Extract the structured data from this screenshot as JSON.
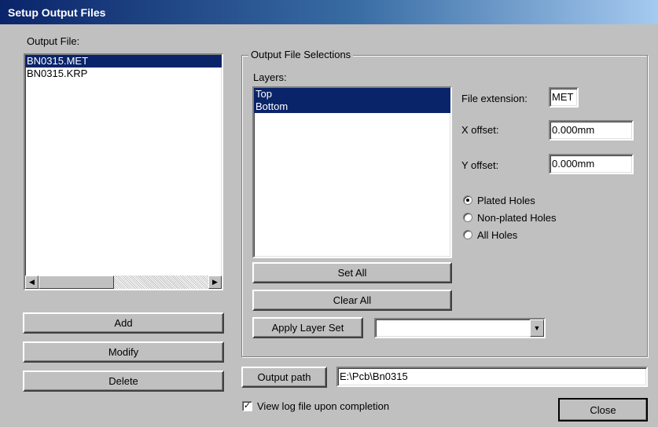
{
  "window": {
    "title": "Setup Output Files"
  },
  "output_file": {
    "label": "Output File:",
    "items": [
      "BN0315.MET",
      "BN0315.KRP"
    ],
    "selected_index": 0
  },
  "buttons": {
    "add": "Add",
    "modify": "Modify",
    "delete": "Delete"
  },
  "selections": {
    "group_title": "Output File Selections",
    "layers_label": "Layers:",
    "layers": [
      "Top",
      "Bottom"
    ],
    "set_all": "Set All",
    "clear_all": "Clear All",
    "apply_layer_set": "Apply Layer Set",
    "layer_set_value": "",
    "file_extension_label": "File extension:",
    "file_extension": "MET",
    "x_offset_label": "X offset:",
    "x_offset": "0.000mm",
    "y_offset_label": "Y offset:",
    "y_offset": "0.000mm",
    "holes": {
      "options": [
        "Plated Holes",
        "Non-plated Holes",
        "All Holes"
      ],
      "selected": "Plated Holes"
    }
  },
  "output_path": {
    "button": "Output path",
    "value": "E:\\Pcb\\Bn0315"
  },
  "view_log": {
    "label": "View log file upon completion",
    "checked": true
  },
  "close": "Close"
}
